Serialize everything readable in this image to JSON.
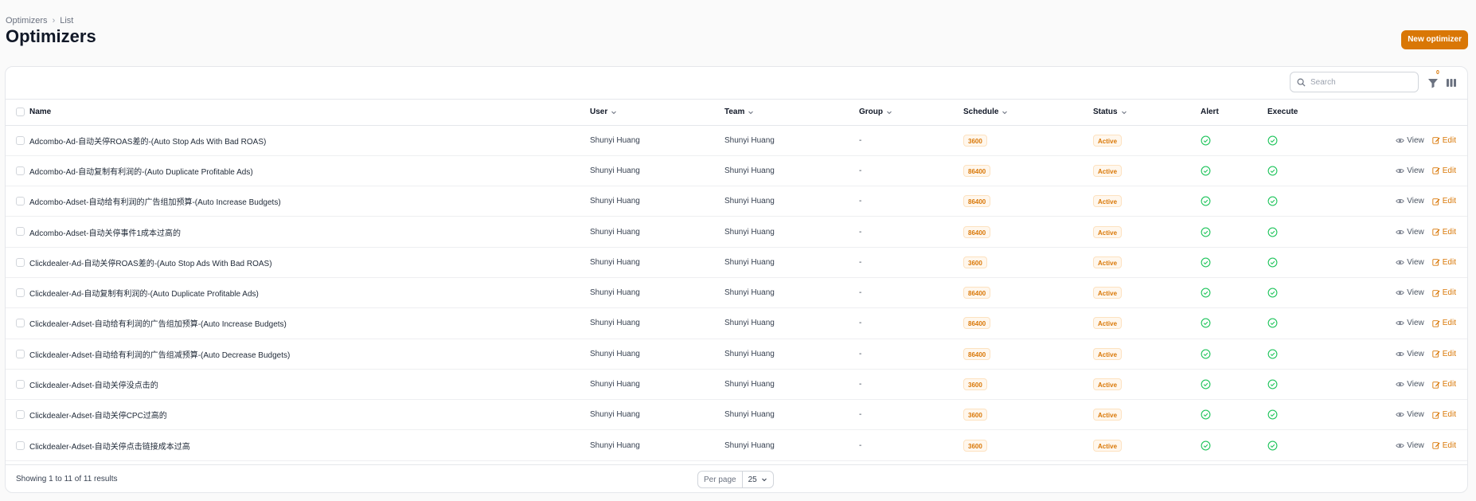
{
  "breadcrumb": {
    "root": "Optimizers",
    "current": "List"
  },
  "page": {
    "title": "Optimizers",
    "new_button": "New optimizer"
  },
  "toolbar": {
    "search_placeholder": "Search",
    "filter_count": "0"
  },
  "table": {
    "headers": {
      "name": "Name",
      "user": "User",
      "team": "Team",
      "group": "Group",
      "schedule": "Schedule",
      "status": "Status",
      "alert": "Alert",
      "execute": "Execute"
    },
    "rows": [
      {
        "name": "Adcombo-Ad-自动关停ROAS差的-(Auto Stop Ads With Bad ROAS)",
        "user": "Shunyi Huang",
        "team": "Shunyi Huang",
        "group": "-",
        "schedule": "3600",
        "status": "Active",
        "view": "View",
        "edit": "Edit"
      },
      {
        "name": "Adcombo-Ad-自动复制有利润的-(Auto Duplicate Profitable Ads)",
        "user": "Shunyi Huang",
        "team": "Shunyi Huang",
        "group": "-",
        "schedule": "86400",
        "status": "Active",
        "view": "View",
        "edit": "Edit"
      },
      {
        "name": "Adcombo-Adset-自动给有利润的广告组加预算-(Auto Increase Budgets)",
        "user": "Shunyi Huang",
        "team": "Shunyi Huang",
        "group": "-",
        "schedule": "86400",
        "status": "Active",
        "view": "View",
        "edit": "Edit"
      },
      {
        "name": "Adcombo-Adset-自动关停事件1成本过高的",
        "user": "Shunyi Huang",
        "team": "Shunyi Huang",
        "group": "-",
        "schedule": "86400",
        "status": "Active",
        "view": "View",
        "edit": "Edit"
      },
      {
        "name": "Clickdealer-Ad-自动关停ROAS差的-(Auto Stop Ads With Bad ROAS)",
        "user": "Shunyi Huang",
        "team": "Shunyi Huang",
        "group": "-",
        "schedule": "3600",
        "status": "Active",
        "view": "View",
        "edit": "Edit"
      },
      {
        "name": "Clickdealer-Ad-自动复制有利润的-(Auto Duplicate Profitable Ads)",
        "user": "Shunyi Huang",
        "team": "Shunyi Huang",
        "group": "-",
        "schedule": "86400",
        "status": "Active",
        "view": "View",
        "edit": "Edit"
      },
      {
        "name": "Clickdealer-Adset-自动给有利润的广告组加预算-(Auto Increase Budgets)",
        "user": "Shunyi Huang",
        "team": "Shunyi Huang",
        "group": "-",
        "schedule": "86400",
        "status": "Active",
        "view": "View",
        "edit": "Edit"
      },
      {
        "name": "Clickdealer-Adset-自动给有利润的广告组减预算-(Auto Decrease Budgets)",
        "user": "Shunyi Huang",
        "team": "Shunyi Huang",
        "group": "-",
        "schedule": "86400",
        "status": "Active",
        "view": "View",
        "edit": "Edit"
      },
      {
        "name": "Clickdealer-Adset-自动关停没点击的",
        "user": "Shunyi Huang",
        "team": "Shunyi Huang",
        "group": "-",
        "schedule": "3600",
        "status": "Active",
        "view": "View",
        "edit": "Edit"
      },
      {
        "name": "Clickdealer-Adset-自动关停CPC过高的",
        "user": "Shunyi Huang",
        "team": "Shunyi Huang",
        "group": "-",
        "schedule": "3600",
        "status": "Active",
        "view": "View",
        "edit": "Edit"
      },
      {
        "name": "Clickdealer-Adset-自动关停点击链接成本过高",
        "user": "Shunyi Huang",
        "team": "Shunyi Huang",
        "group": "-",
        "schedule": "3600",
        "status": "Active",
        "view": "View",
        "edit": "Edit"
      }
    ]
  },
  "footer": {
    "showing": "Showing 1 to 11 of 11 results",
    "per_page_label": "Per page",
    "per_page_value": "25"
  },
  "colors": {
    "accent": "#d97706",
    "success": "#22c55e",
    "badge_bg": "#fff7ed"
  }
}
